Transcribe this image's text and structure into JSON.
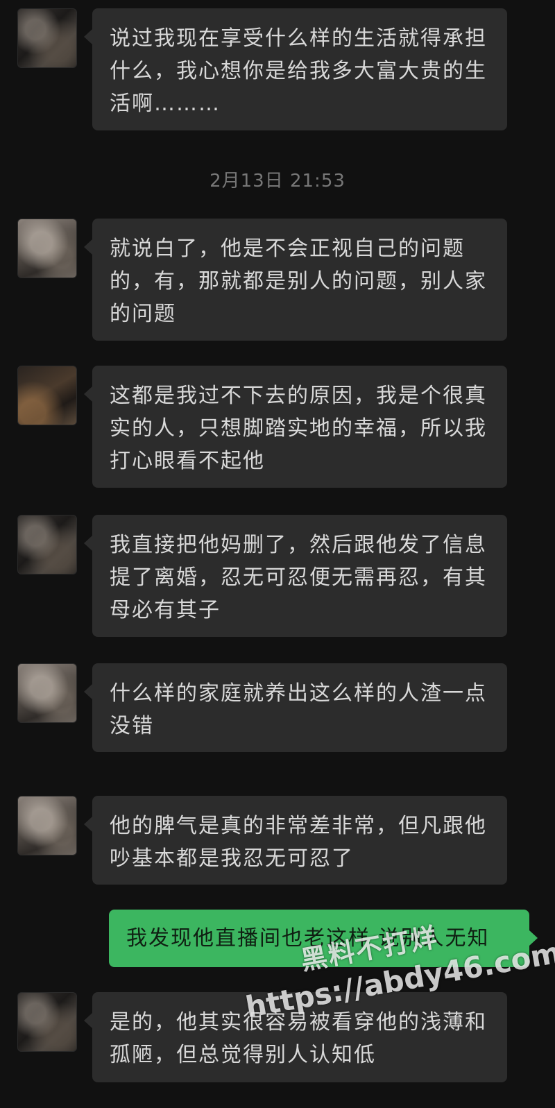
{
  "messages": [
    {
      "side": "in",
      "text": "说过我现在享受什么样的生活就得承担什么，我心想你是给我多大富大贵的生活啊………"
    },
    {
      "side": "in",
      "text": "就说白了，他是不会正视自己的问题的，有，那就都是别人的问题，别人家的问题"
    },
    {
      "side": "in",
      "text": "这都是我过不下去的原因，我是个很真实的人，只想脚踏实地的幸福，所以我打心眼看不起他"
    },
    {
      "side": "in",
      "text": "我直接把他妈删了，然后跟他发了信息提了离婚，忍无可忍便无需再忍，有其母必有其子"
    },
    {
      "side": "in",
      "text": "什么样的家庭就养出这么样的人渣一点没错"
    },
    {
      "side": "in",
      "text": "他的脾气是真的非常差非常，但凡跟他吵基本都是我忍无可忍了"
    },
    {
      "side": "out",
      "text": "我发现他直播间也老这样 说别人无知"
    },
    {
      "side": "in",
      "text": "是的，他其实很容易被看穿他的浅薄和孤陋，但总觉得别人认知低"
    }
  ],
  "timestamp": "2月13日 21:53",
  "watermark": {
    "line1": "黑料不打烊",
    "line2": "https://abdy46.com"
  },
  "colors": {
    "background": "#111111",
    "incoming_bubble": "#2c2c2c",
    "outgoing_bubble": "#3cb660",
    "incoming_text": "#d8d8d8",
    "timestamp_text": "#777777"
  }
}
